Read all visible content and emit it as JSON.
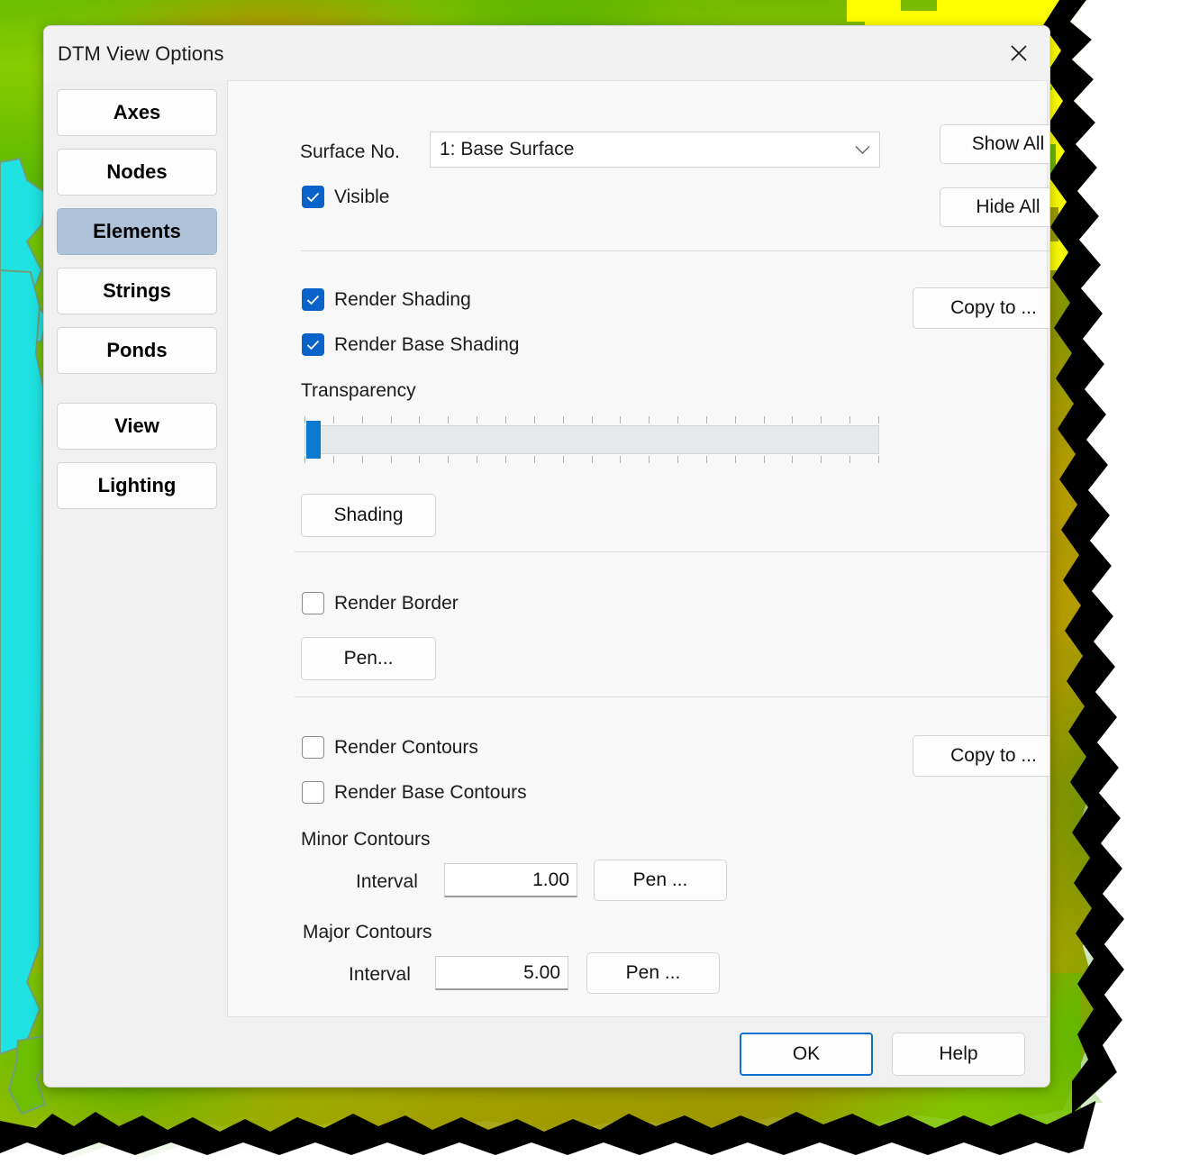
{
  "window": {
    "title": "DTM View Options",
    "close_icon": "close-icon"
  },
  "sidebar": {
    "items": [
      {
        "label": "Axes",
        "selected": false
      },
      {
        "label": "Nodes",
        "selected": false
      },
      {
        "label": "Elements",
        "selected": true
      },
      {
        "label": "Strings",
        "selected": false
      },
      {
        "label": "Ponds",
        "selected": false
      },
      {
        "label": "View",
        "selected": false
      },
      {
        "label": "Lighting",
        "selected": false
      }
    ]
  },
  "surface": {
    "label": "Surface No.",
    "selected_option": "1: Base Surface",
    "options": [
      "1: Base Surface"
    ],
    "chevron_icon": "chevron-down-icon",
    "visible_checkbox": {
      "label": "Visible",
      "checked": true
    },
    "show_all_button": "Show All",
    "hide_all_button": "Hide All"
  },
  "shading": {
    "render_shading": {
      "label": "Render Shading",
      "checked": true
    },
    "render_base_shading": {
      "label": "Render Base Shading",
      "checked": true
    },
    "transparency_label": "Transparency",
    "transparency_value": 0,
    "transparency_min": 0,
    "transparency_max": 100,
    "transparency_ticks": 21,
    "shading_button": "Shading",
    "copy_to_button": "Copy to ..."
  },
  "border": {
    "render_border": {
      "label": "Render Border",
      "checked": false
    },
    "pen_button": "Pen..."
  },
  "contours": {
    "render_contours": {
      "label": "Render Contours",
      "checked": false
    },
    "render_base_contours": {
      "label": "Render Base Contours",
      "checked": false
    },
    "copy_to_button": "Copy to ...",
    "minor": {
      "heading": "Minor Contours",
      "interval_label": "Interval",
      "interval_value": "1.00",
      "pen_button": "Pen ..."
    },
    "major": {
      "heading": "Major Contours",
      "interval_label": "Interval",
      "interval_value": "5.00",
      "pen_button": "Pen ..."
    }
  },
  "footer": {
    "ok_button": "OK",
    "help_button": "Help"
  },
  "colors": {
    "accent": "#0a63c8",
    "slider_thumb": "#0a7bd0",
    "selected_tab": "#aec3d9",
    "focus_border": "#0a72cf",
    "dialog_bg": "#f0f0f0",
    "panel_bg": "#f8f8f8"
  },
  "background": {
    "description": "dtm-terrain-heatmap",
    "palette": [
      "#00e5e5",
      "#55cc00",
      "#8fd400",
      "#a8a800",
      "#ffff00",
      "#cc7a00",
      "#000000"
    ]
  }
}
